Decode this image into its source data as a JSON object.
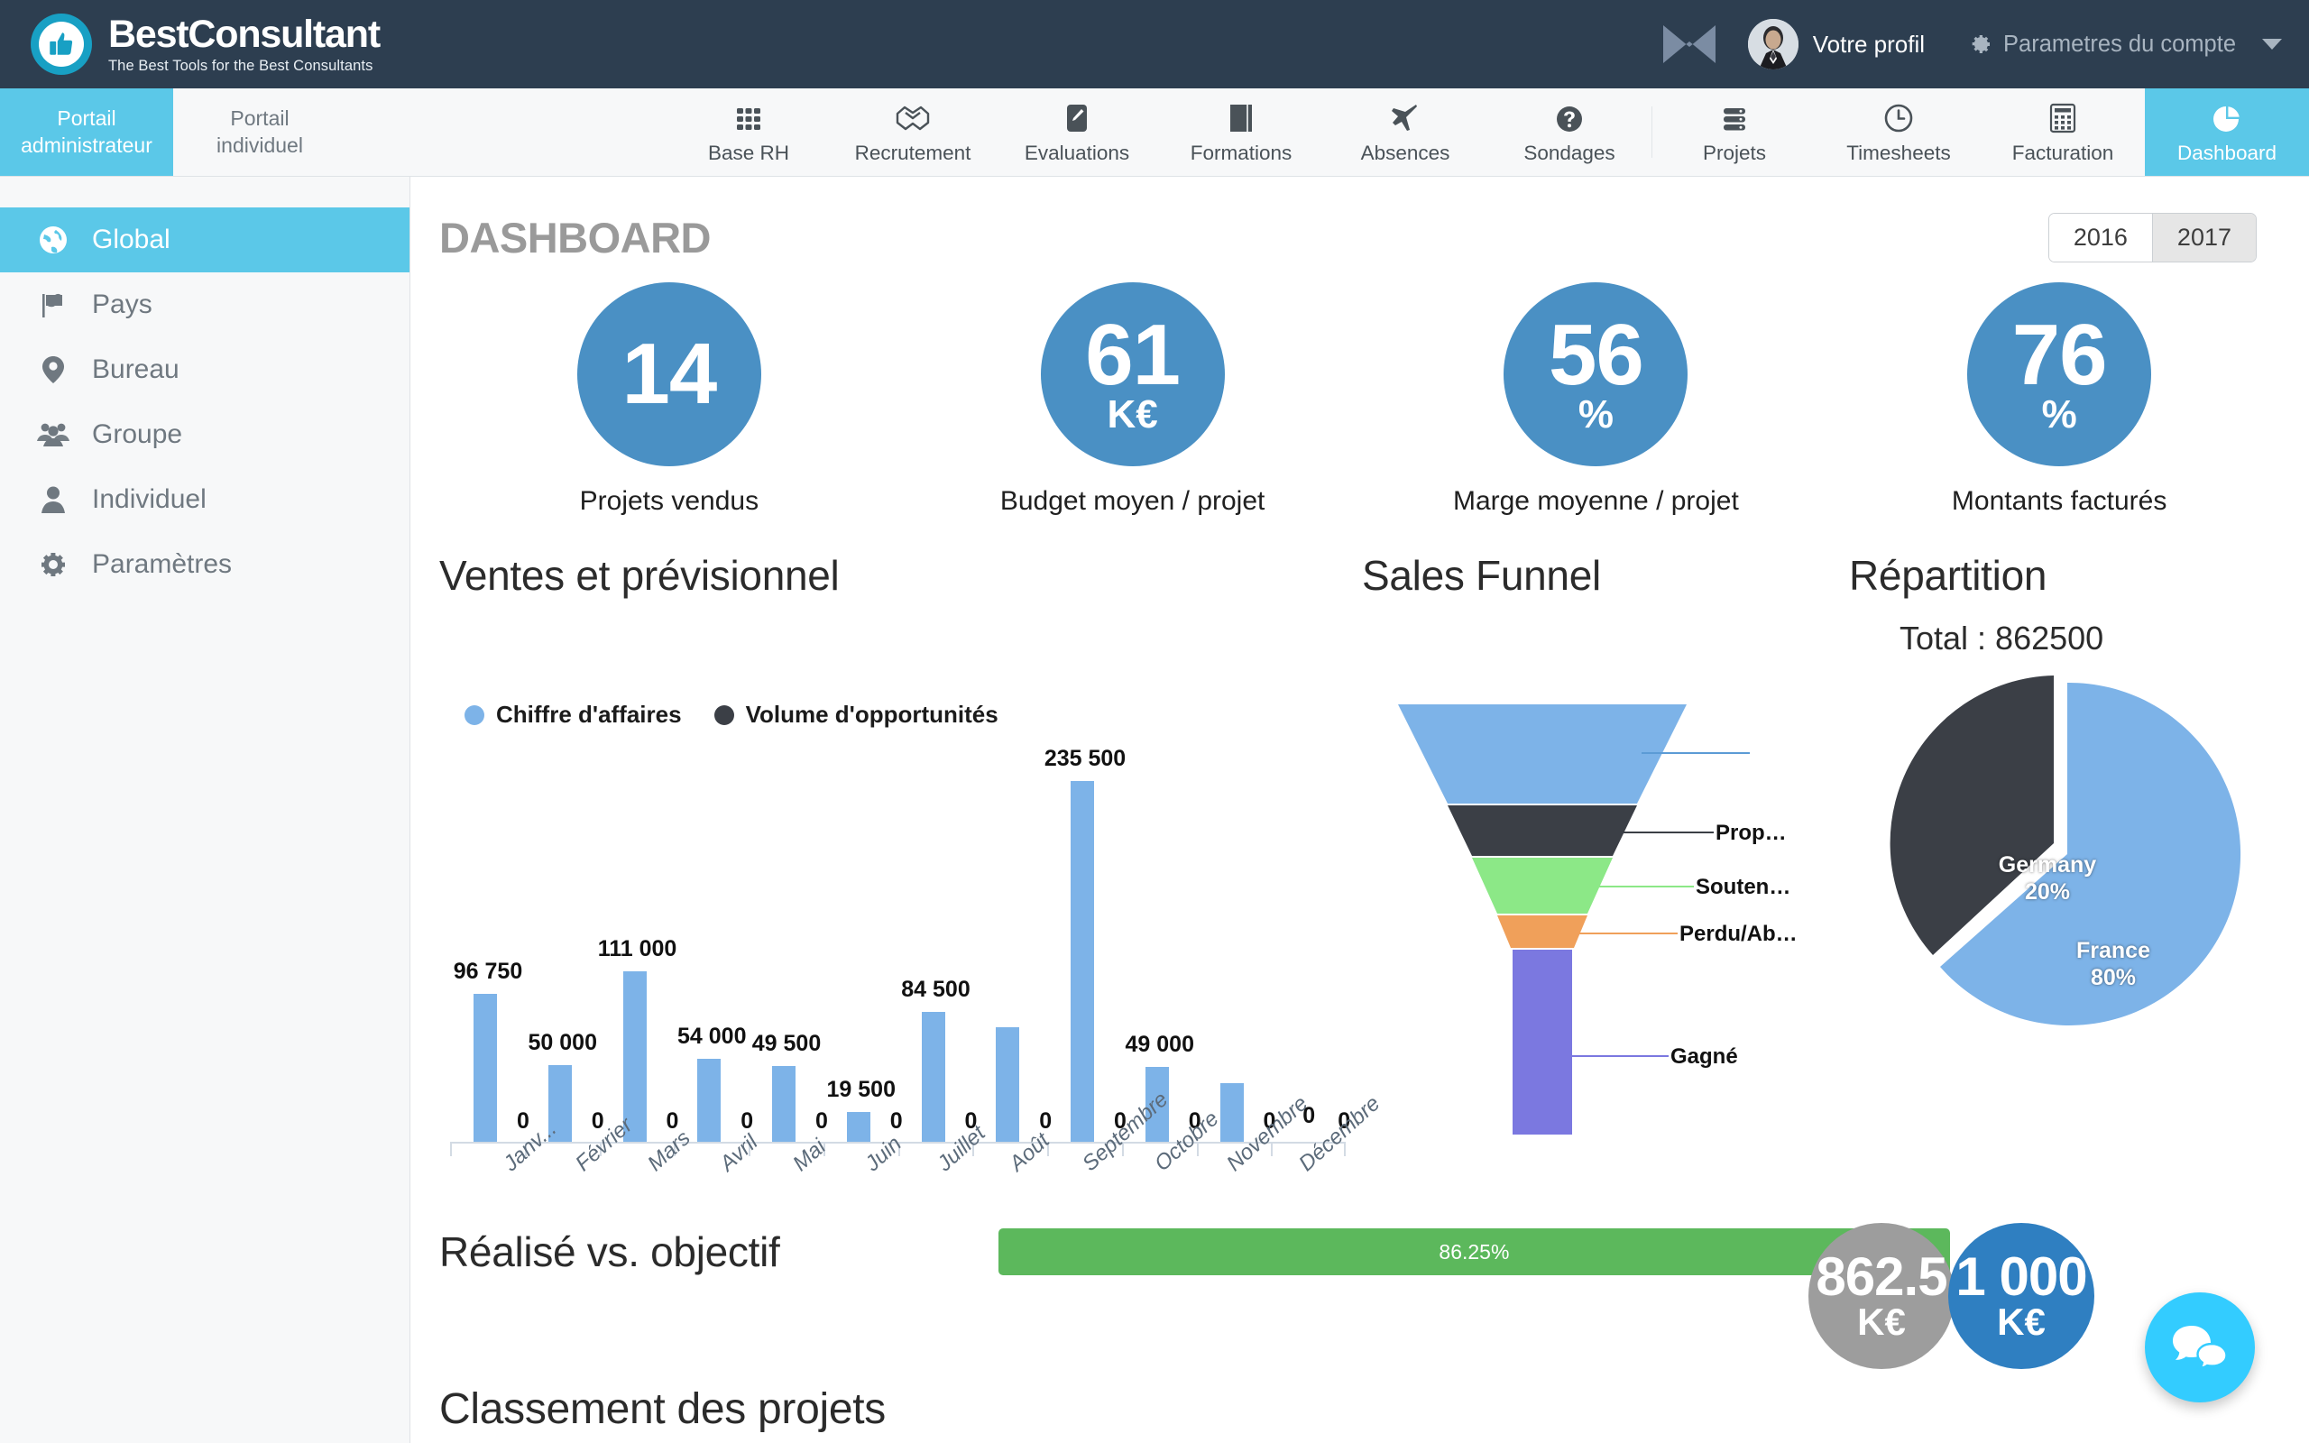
{
  "brand": {
    "title": "BestConsultant",
    "tagline": "The Best Tools for the Best Consultants",
    "logo_icon": "thumbs-up-circle-icon"
  },
  "header": {
    "mail_icon": "envelope-icon",
    "profile_name": "Votre profil",
    "avatar_icon": "user-photo-avatar",
    "account_settings": "Parametres du compte",
    "gear_icon": "gear-icon",
    "caret_icon": "chevron-down-icon"
  },
  "portal_tabs": [
    {
      "line1": "Portail",
      "line2": "administrateur",
      "active": true
    },
    {
      "line1": "Portail",
      "line2": "individuel",
      "active": false
    }
  ],
  "nav_items": [
    {
      "label": "Base RH",
      "icon": "grid-dots-icon",
      "active": false
    },
    {
      "label": "Recrutement",
      "icon": "handshake-icon",
      "active": false
    },
    {
      "label": "Evaluations",
      "icon": "pencil-note-icon",
      "active": false
    },
    {
      "label": "Formations",
      "icon": "book-icon",
      "active": false
    },
    {
      "label": "Absences",
      "icon": "airplane-icon",
      "active": false
    },
    {
      "label": "Sondages",
      "icon": "question-circle-icon",
      "active": false
    },
    {
      "label": "Projets",
      "icon": "server-stack-icon",
      "active": false
    },
    {
      "label": "Timesheets",
      "icon": "clock-icon",
      "active": false
    },
    {
      "label": "Facturation",
      "icon": "calculator-icon",
      "active": false
    },
    {
      "label": "Dashboard",
      "icon": "pie-chart-icon",
      "active": true
    }
  ],
  "sidebar": {
    "items": [
      {
        "label": "Global",
        "icon": "globe-icon",
        "active": true
      },
      {
        "label": "Pays",
        "icon": "flag-icon",
        "active": false
      },
      {
        "label": "Bureau",
        "icon": "map-pin-icon",
        "active": false
      },
      {
        "label": "Groupe",
        "icon": "users-icon",
        "active": false
      },
      {
        "label": "Individuel",
        "icon": "user-icon",
        "active": false
      },
      {
        "label": "Paramètres",
        "icon": "gear-icon",
        "active": false
      }
    ]
  },
  "page": {
    "title": "DASHBOARD",
    "years": [
      {
        "label": "2016",
        "active": false
      },
      {
        "label": "2017",
        "active": true
      }
    ]
  },
  "kpis": [
    {
      "value": "14",
      "unit": "",
      "label": "Projets vendus"
    },
    {
      "value": "61",
      "unit": "K€",
      "label": "Budget moyen / projet"
    },
    {
      "value": "56",
      "unit": "%",
      "label": "Marge moyenne / projet"
    },
    {
      "value": "76",
      "unit": "%",
      "label": "Montants facturés"
    }
  ],
  "sections": {
    "sales_title": "Ventes et prévisionnel",
    "funnel_title": "Sales Funnel",
    "pie_title": "Répartition",
    "pie_total": "Total : 862500",
    "realise_title": "Réalisé vs. objectif",
    "bottom_title": "Classement des projets"
  },
  "realise": {
    "percent_label": "86.25%",
    "percent_value": 86.25,
    "actual": {
      "num": "862.5",
      "unit": "K€",
      "color": "#9d9d9d"
    },
    "target": {
      "num": "1 000",
      "unit": "K€",
      "color": "#2f7fc1"
    }
  },
  "chat": {
    "icon": "chat-bubbles-icon"
  },
  "colors": {
    "brand_dark": "#2d3e50",
    "accent": "#5bc8e8",
    "kpi_blue": "#4a90c4",
    "bar_blue": "#7db3e8",
    "green": "#5cb85c",
    "dark_slate": "#3b3f46"
  },
  "chart_data": [
    {
      "type": "bar",
      "title": "Ventes et prévisionnel",
      "xlabel": "",
      "ylabel": "",
      "grid": false,
      "legend_position": "top-left",
      "legend": [
        "Chiffre d'affaires",
        "Volume d'opportunités"
      ],
      "series_colors": [
        "#7db3e8",
        "#3b3f46"
      ],
      "categories": [
        "Janv...",
        "Février",
        "Mars",
        "Avril",
        "Mai",
        "Juin",
        "Juillet",
        "Août",
        "Septembre",
        "Octobre",
        "Novembre",
        "Décembre"
      ],
      "ylim": [
        0,
        235500
      ],
      "series": [
        {
          "name": "Chiffre d'affaires",
          "values": [
            96750,
            50000,
            111000,
            54000,
            49500,
            19500,
            84500,
            75000,
            235500,
            49000,
            38000,
            0
          ],
          "labels": [
            "96 750",
            "50 000",
            "111 000",
            "54 000",
            "49 500",
            "19 500",
            "84 500",
            "",
            "235 500",
            "49 000",
            "",
            "0"
          ]
        },
        {
          "name": "Volume d'opportunités",
          "values": [
            0,
            0,
            0,
            0,
            0,
            0,
            0,
            0,
            0,
            0,
            0,
            0
          ],
          "labels": [
            "0",
            "0",
            "0",
            "0",
            "0",
            "0",
            "0",
            "0",
            "0",
            "0",
            "0",
            "0"
          ]
        }
      ]
    },
    {
      "type": "funnel",
      "title": "Sales Funnel",
      "stages": [
        {
          "label": "",
          "color": "#7db3e8",
          "show_label": false
        },
        {
          "label": "Prop…",
          "color": "#3b3f46",
          "show_label": true
        },
        {
          "label": "Souten…",
          "color": "#8ce887",
          "show_label": true
        },
        {
          "label": "Perdu/Ab…",
          "color": "#f0a05a",
          "show_label": true
        },
        {
          "label": "Gagné",
          "color": "#7b78e0",
          "show_label": true
        }
      ]
    },
    {
      "type": "pie",
      "title": "Répartition",
      "total": 862500,
      "total_label": "Total : 862500",
      "labels": [
        "France",
        "Germany"
      ],
      "values": [
        80,
        20
      ],
      "value_labels": [
        "80%",
        "20%"
      ],
      "colors": [
        "#7db3e8",
        "#3b3f46"
      ]
    }
  ]
}
